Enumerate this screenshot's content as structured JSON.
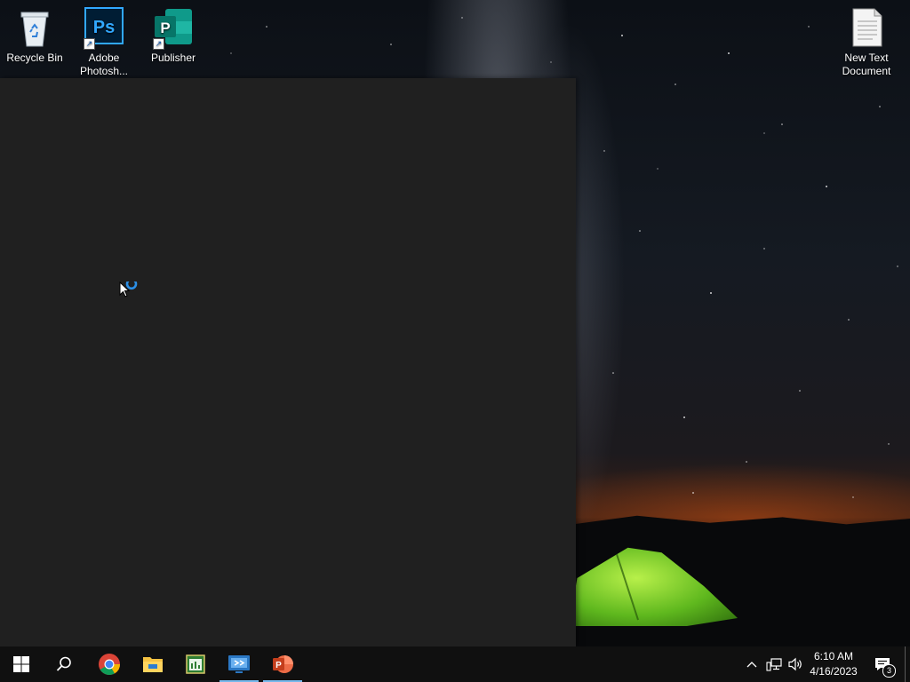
{
  "desktop": {
    "icons": [
      {
        "label": "Recycle Bin"
      },
      {
        "label": "Adobe Photosh..."
      },
      {
        "label": "Publisher"
      },
      {
        "label": "New Text Document"
      }
    ]
  },
  "taskbar": {
    "start_icon": "windows-logo-icon",
    "search_icon": "search-icon",
    "pinned": [
      {
        "icon": "chrome-icon"
      },
      {
        "icon": "file-explorer-icon"
      },
      {
        "icon": "spreadsheet-app-icon"
      },
      {
        "icon": "remote-desktop-icon"
      },
      {
        "icon": "powerpoint-icon"
      }
    ]
  },
  "system_tray": {
    "time": "6:10 AM",
    "date": "4/16/2023",
    "notification_count": "3"
  },
  "colors": {
    "taskbar": "#101010",
    "window": "#202020",
    "accent": "#76b9ed"
  }
}
